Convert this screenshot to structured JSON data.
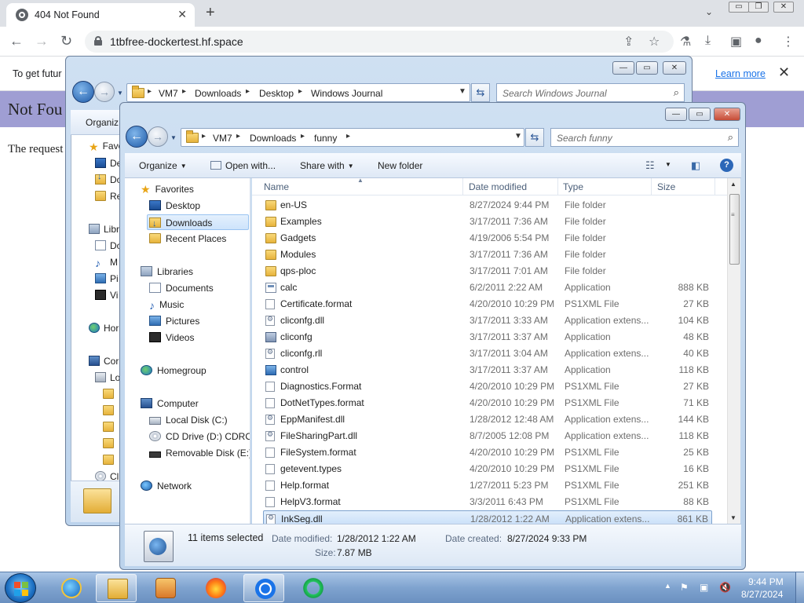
{
  "browser": {
    "tab_title": "404 Not Found",
    "tab_close": "✕",
    "new_tab": "+",
    "tab_search": "⌄",
    "window_controls": [
      "▭",
      "❐",
      "✕"
    ],
    "url": "1tbfree-dockertest.hf.space",
    "infobar_text": "To get futur",
    "infobar_link": "Learn more",
    "infobar_close": "✕",
    "page_heading": "Not Fou",
    "page_text": "The request"
  },
  "back_window": {
    "breadcrumb": [
      "VM7",
      "Downloads",
      "Desktop",
      "Windows Journal"
    ],
    "search_placeholder": "Search Windows Journal",
    "command": "Organiz",
    "nav_items": [
      "Favo",
      "De",
      "Do",
      "Re",
      "Libr",
      "Do",
      "M",
      "Pi",
      "Vi",
      "Hor",
      "Cor",
      "Lo",
      "Cl"
    ]
  },
  "front_window": {
    "breadcrumb": [
      "VM7",
      "Downloads",
      "funny"
    ],
    "search_placeholder": "Search funny",
    "commands": {
      "organize": "Organize",
      "open_with": "Open with...",
      "share_with": "Share with",
      "new_folder": "New folder"
    },
    "nav": {
      "favorites": "Favorites",
      "desktop": "Desktop",
      "downloads": "Downloads",
      "recent": "Recent Places",
      "libraries": "Libraries",
      "documents": "Documents",
      "music": "Music",
      "pictures": "Pictures",
      "videos": "Videos",
      "homegroup": "Homegroup",
      "computer": "Computer",
      "local_disk": "Local Disk (C:)",
      "cd_drive": "CD Drive (D:) CDROM",
      "removable": "Removable Disk (E:)",
      "network": "Network"
    },
    "columns": {
      "name": "Name",
      "date": "Date modified",
      "type": "Type",
      "size": "Size"
    },
    "files": [
      {
        "name": "en-US",
        "date": "8/27/2024 9:44 PM",
        "type": "File folder",
        "size": "",
        "icon": "folder"
      },
      {
        "name": "Examples",
        "date": "3/17/2011 7:36 AM",
        "type": "File folder",
        "size": "",
        "icon": "folder"
      },
      {
        "name": "Gadgets",
        "date": "4/19/2006 5:54 PM",
        "type": "File folder",
        "size": "",
        "icon": "folder"
      },
      {
        "name": "Modules",
        "date": "3/17/2011 7:36 AM",
        "type": "File folder",
        "size": "",
        "icon": "folder"
      },
      {
        "name": "qps-ploc",
        "date": "3/17/2011 7:01 AM",
        "type": "File folder",
        "size": "",
        "icon": "folder"
      },
      {
        "name": "calc",
        "date": "6/2/2011 2:22 AM",
        "type": "Application",
        "size": "888 KB",
        "icon": "app"
      },
      {
        "name": "Certificate.format",
        "date": "4/20/2010 10:29 PM",
        "type": "PS1XML File",
        "size": "27 KB",
        "icon": "file"
      },
      {
        "name": "cliconfg.dll",
        "date": "3/17/2011 3:33 AM",
        "type": "Application extens...",
        "size": "104 KB",
        "icon": "dll"
      },
      {
        "name": "cliconfg",
        "date": "3/17/2011 3:37 AM",
        "type": "Application",
        "size": "48 KB",
        "icon": "cfg"
      },
      {
        "name": "cliconfg.rll",
        "date": "3/17/2011 3:04 AM",
        "type": "Application extens...",
        "size": "40 KB",
        "icon": "dll"
      },
      {
        "name": "control",
        "date": "3/17/2011 3:37 AM",
        "type": "Application",
        "size": "118 KB",
        "icon": "ctrl"
      },
      {
        "name": "Diagnostics.Format",
        "date": "4/20/2010 10:29 PM",
        "type": "PS1XML File",
        "size": "27 KB",
        "icon": "file"
      },
      {
        "name": "DotNetTypes.format",
        "date": "4/20/2010 10:29 PM",
        "type": "PS1XML File",
        "size": "71 KB",
        "icon": "file"
      },
      {
        "name": "EppManifest.dll",
        "date": "1/28/2012 12:48 AM",
        "type": "Application extens...",
        "size": "144 KB",
        "icon": "dll"
      },
      {
        "name": "FileSharingPart.dll",
        "date": "8/7/2005 12:08 PM",
        "type": "Application extens...",
        "size": "118 KB",
        "icon": "dll"
      },
      {
        "name": "FileSystem.format",
        "date": "4/20/2010 10:29 PM",
        "type": "PS1XML File",
        "size": "25 KB",
        "icon": "file"
      },
      {
        "name": "getevent.types",
        "date": "4/20/2010 10:29 PM",
        "type": "PS1XML File",
        "size": "16 KB",
        "icon": "file"
      },
      {
        "name": "Help.format",
        "date": "1/27/2011 5:23 PM",
        "type": "PS1XML File",
        "size": "251 KB",
        "icon": "file"
      },
      {
        "name": "HelpV3.format",
        "date": "3/3/2011 6:43 PM",
        "type": "PS1XML File",
        "size": "88 KB",
        "icon": "file"
      },
      {
        "name": "InkSeg.dll",
        "date": "1/28/2012 1:22 AM",
        "type": "Application extens...",
        "size": "861 KB",
        "icon": "dll"
      }
    ],
    "selected_row": 19,
    "status": {
      "count": "11 items selected",
      "date_modified_label": "Date modified:",
      "date_modified": "1/28/2012 1:22 AM",
      "date_created_label": "Date created:",
      "date_created": "8/27/2024 9:33 PM",
      "size_label": "Size:",
      "size": "7.87 MB"
    }
  },
  "taskbar": {
    "time": "9:44 PM",
    "date": "8/27/2024",
    "apps": [
      "internet-explorer",
      "windows-explorer",
      "media-player",
      "firefox",
      "chrome",
      "opera"
    ]
  }
}
